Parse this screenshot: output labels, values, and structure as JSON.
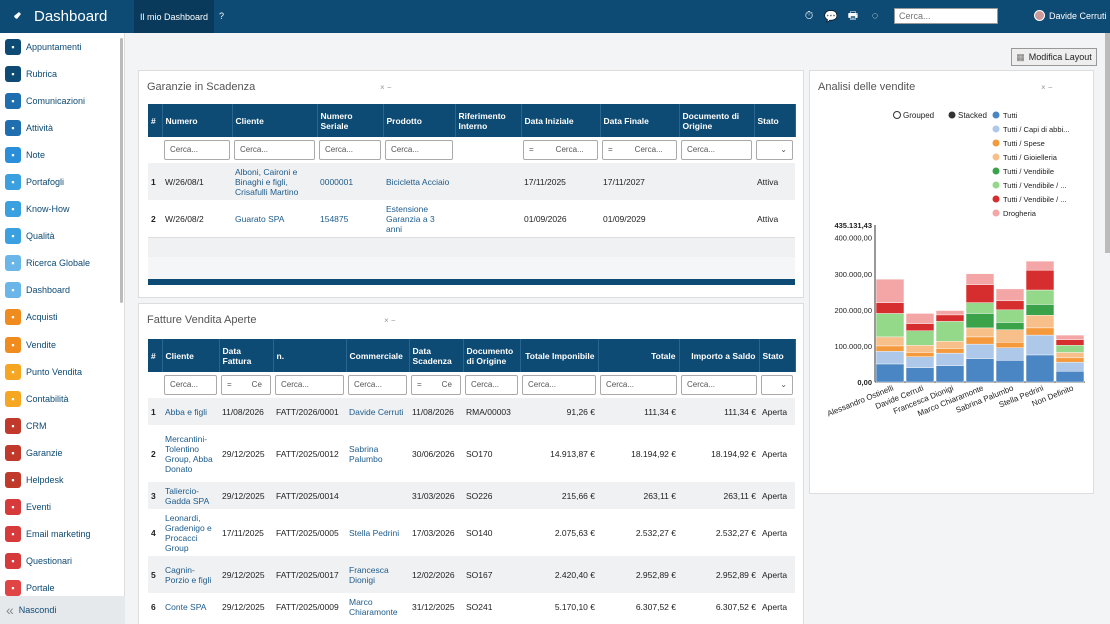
{
  "topbar": {
    "brand": "Dashboard",
    "tab": "Il mio Dashboard",
    "help": "?",
    "search_placeholder": "Cerca...",
    "user": "Davide Cerruti"
  },
  "sidebar": {
    "items": [
      {
        "label": "Appuntamenti",
        "icon": "calendar-icon",
        "color": "#0d4a74"
      },
      {
        "label": "Rubrica",
        "icon": "contacts-icon",
        "color": "#0d4a74"
      },
      {
        "label": "Comunicazioni",
        "icon": "chat-icon",
        "color": "#1e6eb0"
      },
      {
        "label": "Attività",
        "icon": "check-icon",
        "color": "#1e6eb0"
      },
      {
        "label": "Note",
        "icon": "note-icon",
        "color": "#2a8fd8"
      },
      {
        "label": "Portafogli",
        "icon": "wallet-icon",
        "color": "#3aa0e0"
      },
      {
        "label": "Know-How",
        "icon": "brain-icon",
        "color": "#3aa0e0"
      },
      {
        "label": "Qualità",
        "icon": "quality-icon",
        "color": "#3aa0e0"
      },
      {
        "label": "Ricerca Globale",
        "icon": "search-icon",
        "color": "#6ab6e8"
      },
      {
        "label": "Dashboard",
        "icon": "dashboard-icon",
        "color": "#6ab6e8"
      },
      {
        "label": "Acquisti",
        "icon": "cart-icon",
        "color": "#f08c1e"
      },
      {
        "label": "Vendite",
        "icon": "sales-icon",
        "color": "#f08c1e"
      },
      {
        "label": "Punto Vendita",
        "icon": "pos-icon",
        "color": "#f5a623"
      },
      {
        "label": "Contabilità",
        "icon": "accounting-icon",
        "color": "#f5a623"
      },
      {
        "label": "CRM",
        "icon": "crm-icon",
        "color": "#c0392b"
      },
      {
        "label": "Garanzie",
        "icon": "shield-icon",
        "color": "#c0392b"
      },
      {
        "label": "Helpdesk",
        "icon": "helpdesk-icon",
        "color": "#c0392b"
      },
      {
        "label": "Eventi",
        "icon": "event-icon",
        "color": "#d63a3a"
      },
      {
        "label": "Email marketing",
        "icon": "email-icon",
        "color": "#d63a3a"
      },
      {
        "label": "Questionari",
        "icon": "survey-icon",
        "color": "#d63a3a"
      },
      {
        "label": "Portale",
        "icon": "portal-icon",
        "color": "#e04444"
      }
    ],
    "hide": "Nascondi"
  },
  "main": {
    "layout_button": "Modifica Layout"
  },
  "garanzie": {
    "title": "Garanzie in Scadenza",
    "headers": [
      "#",
      "Numero",
      "Cliente",
      "Numero Seriale",
      "Prodotto",
      "Riferimento Interno",
      "Data Iniziale",
      "Data Finale",
      "Documento di Origine",
      "Stato"
    ],
    "filter": "Cerca...",
    "eq": "=",
    "rows": [
      [
        "1",
        "W/26/08/1",
        "Alboni, Caironi e Binaghi e figli, Crisafulli Martino",
        "0000001",
        "Bicicletta Acciaio",
        "",
        "17/11/2025",
        "17/11/2027",
        "",
        "Attiva"
      ],
      [
        "2",
        "W/26/08/2",
        "Guarato SPA",
        "154875",
        "Estensione Garanzia a 3 anni",
        "",
        "01/09/2026",
        "01/09/2029",
        "",
        "Attiva"
      ]
    ]
  },
  "fatture": {
    "title": "Fatture Vendita Aperte",
    "headers": [
      "#",
      "Cliente",
      "Data Fattura",
      "n.",
      "Commerciale",
      "Data Scadenza",
      "Documento di Origine",
      "Totale Imponibile",
      "Totale",
      "Importo a Saldo",
      "Stato"
    ],
    "filter": "Cerca...",
    "filter_short": "Ce",
    "eq": "=",
    "rows": [
      [
        "1",
        "Abba e figli",
        "11/08/2026",
        "FATT/2026/0001",
        "Davide Cerruti",
        "11/08/2026",
        "RMA/00003",
        "91,26 €",
        "111,34 €",
        "111,34 €",
        "Aperta"
      ],
      [
        "2",
        "Mercantini-Tolentino Group, Abba Donato",
        "29/12/2025",
        "FATT/2025/0012",
        "Sabrina Palumbo",
        "30/06/2026",
        "SO170",
        "14.913,87 €",
        "18.194,92 €",
        "18.194,92 €",
        "Aperta"
      ],
      [
        "3",
        "Taliercio-Gadda SPA",
        "29/12/2025",
        "FATT/2025/0014",
        "",
        "31/03/2026",
        "SO226",
        "215,66 €",
        "263,11 €",
        "263,11 €",
        "Aperta"
      ],
      [
        "4",
        "Leonardi, Gradenigo e Procacci Group",
        "17/11/2025",
        "FATT/2025/0005",
        "Stella Pedrini",
        "17/03/2026",
        "SO140",
        "2.075,63 €",
        "2.532,27 €",
        "2.532,27 €",
        "Aperta"
      ],
      [
        "5",
        "Cagnin-Porzio e figli",
        "29/12/2025",
        "FATT/2025/0017",
        "Francesca Dionigi",
        "12/02/2026",
        "SO167",
        "2.420,40 €",
        "2.952,89 €",
        "2.952,89 €",
        "Aperta"
      ],
      [
        "6",
        "Conte SPA",
        "29/12/2025",
        "FATT/2025/0009",
        "Marco Chiaramonte",
        "31/12/2025",
        "SO241",
        "5.170,10 €",
        "6.307,52 €",
        "6.307,52 €",
        "Aperta"
      ]
    ]
  },
  "analisi": {
    "title": "Analisi delle vendite",
    "mode_grouped": "Grouped",
    "mode_stacked": "Stacked",
    "legend": [
      {
        "name": "Tutti",
        "color": "#4a86c4"
      },
      {
        "name": "Tutti / Capi di abbi...",
        "color": "#aec8ea"
      },
      {
        "name": "Tutti / Spese",
        "color": "#f59a3c"
      },
      {
        "name": "Tutti / Gioielleria",
        "color": "#f7c08a"
      },
      {
        "name": "Tutti / Vendibile",
        "color": "#3aa34a"
      },
      {
        "name": "Tutti / Vendibile / ...",
        "color": "#94d88a"
      },
      {
        "name": "Tutti / Vendibile / ...",
        "color": "#d62e2e"
      },
      {
        "name": "Drogheria",
        "color": "#f4a6a6"
      }
    ]
  },
  "chart_data": {
    "type": "bar",
    "title": "",
    "max_label": "435.131,43",
    "y_ticks": [
      "400.000,00",
      "300.000,00",
      "200.000,00",
      "100.000,00",
      "0,00"
    ],
    "ylim": [
      0,
      435131.43
    ],
    "categories": [
      "Alessandro Ostinelli",
      "Davide Cerruti",
      "Francesca Dionigi",
      "Marco Chiaramonte",
      "Sabrina Palumbo",
      "Stella Pedrini",
      "Non Definito"
    ],
    "series": [
      {
        "name": "Tutti",
        "values": [
          50000,
          40000,
          45000,
          65000,
          60000,
          75000,
          30000
        ]
      },
      {
        "name": "Tutti / Capi di abbi...",
        "values": [
          35000,
          30000,
          35000,
          40000,
          35000,
          55000,
          25000
        ]
      },
      {
        "name": "Tutti / Spese",
        "values": [
          15000,
          12000,
          13000,
          20000,
          15000,
          20000,
          12000
        ]
      },
      {
        "name": "Tutti / Gioielleria",
        "values": [
          25000,
          20000,
          20000,
          25000,
          35000,
          35000,
          15000
        ]
      },
      {
        "name": "Tutti / Vendibile",
        "values": [
          0,
          0,
          0,
          40000,
          20000,
          30000,
          0
        ]
      },
      {
        "name": "Tutti / Vendibile / ...",
        "values": [
          65000,
          40000,
          55000,
          30000,
          35000,
          40000,
          20000
        ]
      },
      {
        "name": "Tutti / Vendibile / ...",
        "values": [
          30000,
          20000,
          18000,
          50000,
          25000,
          55000,
          15000
        ]
      },
      {
        "name": "Drogheria",
        "values": [
          65000,
          28000,
          12000,
          30000,
          33000,
          25000,
          13000
        ]
      }
    ]
  }
}
